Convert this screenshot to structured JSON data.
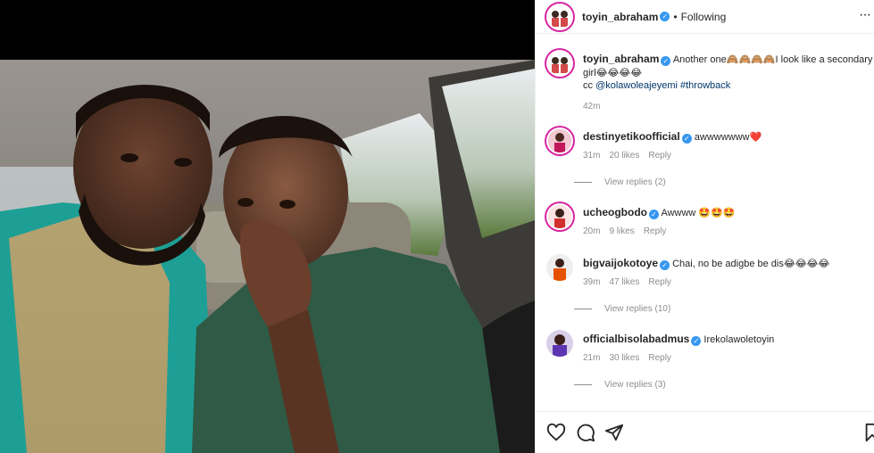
{
  "post": {
    "username": "toyin_abraham",
    "follow_label": "Following",
    "more_label": "···"
  },
  "caption": {
    "username": "toyin_abraham",
    "text": "Another one🙈🙈🙈🙈I look like a secondary school girl😂😂😂😂",
    "line2_prefix": "cc ",
    "mention": "@kolawoleajeyemi",
    "hashtag": "#throwback",
    "time": "42m"
  },
  "comments": [
    {
      "username": "destinyetikoofficial",
      "text": "awwwwwww❤️",
      "time": "31m",
      "likes": "20 likes",
      "reply": "Reply",
      "view_replies": "View replies (2)"
    },
    {
      "username": "ucheogbodo",
      "text": "Awwww 🤩🤩🤩",
      "time": "20m",
      "likes": "9 likes",
      "reply": "Reply",
      "view_replies": ""
    },
    {
      "username": "bigvaijokotoye",
      "text": "Chai, no be adigbe be dis😂😂😂😂",
      "time": "39m",
      "likes": "47 likes",
      "reply": "Reply",
      "view_replies": "View replies (10)"
    },
    {
      "username": "officialbisolabadmus",
      "text": "Irekolawoletoyin",
      "time": "21m",
      "likes": "30 likes",
      "reply": "Reply",
      "view_replies": "View replies (3)"
    }
  ],
  "icons": [
    "heart-icon",
    "comment-icon",
    "share-icon",
    "bookmark-icon",
    "more-options-icon",
    "verified-badge-icon"
  ],
  "colors": {
    "verified": "#3897f0",
    "link": "#00376b",
    "meta": "#8e8e8e",
    "story_ring": "#d6249f"
  }
}
